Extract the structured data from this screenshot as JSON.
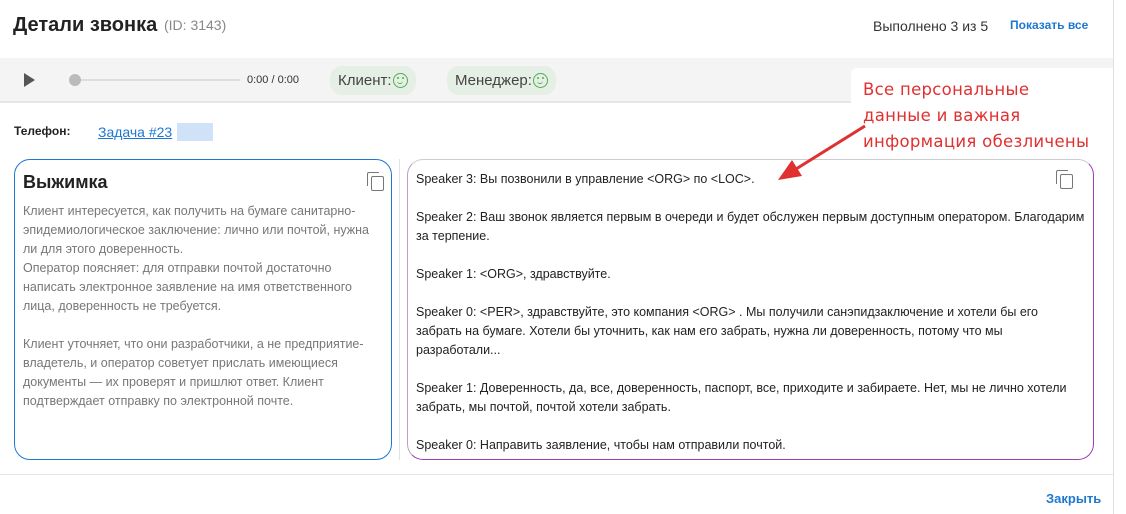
{
  "header": {
    "title": "Детали звонка",
    "call_id": "(ID: 3143)",
    "progress": "Выполнено 3 из 5",
    "show_all": "Показать все"
  },
  "player": {
    "time": "0:00 / 0:00",
    "position_fraction": 0,
    "client_label": "Клиент:",
    "client_mood": "smile-icon",
    "manager_label": "Менеджер:",
    "manager_mood": "smile-icon"
  },
  "info": {
    "phone_label": "Телефон:",
    "task_link": "Задача #23"
  },
  "summary": {
    "title": "Выжимка",
    "text": "Клиент интересуется, как получить на бумаге санитарно-эпидемиологическое заключение: лично или почтой, нужна ли для этого доверенность.\nОператор поясняет: для отправки почтой достаточно написать электронное заявление на имя ответственного лица, доверенность не требуется.\n\nКлиент уточняет, что они разработчики, а не предприятие-владетель, и оператор советует прислать имеющиеся документы — их проверят и пришлют ответ. Клиент подтверждает отправку по электронной почте."
  },
  "transcript": [
    "Speaker 3: Вы позвонили в управление <ORG> по <LOC>.",
    "Speaker 2: Ваш звонок является первым в очереди и будет обслужен первым доступным оператором. Благодарим за терпение.",
    "Speaker 1: <ORG>, здравствуйте.",
    "Speaker 0: <PER>, здравствуйте, это компания <ORG> .  Мы получили санэпидзаключение и хотели бы его забрать на бумаге.  Хотели бы уточнить, как нам его забрать, нужна ли доверенность, потому что мы разработали...",
    "Speaker 1: Доверенность, да, все, доверенность, паспорт, все, приходите и забираете.  Нет, мы не лично хотели забрать, мы почтой, почтой хотели забрать.",
    "Speaker 0: Направить заявление, чтобы нам отправили почтой."
  ],
  "annotation": {
    "text": "Все персональные данные и важная информация обезличены",
    "color": "#e03030"
  },
  "footer": {
    "close": "Закрыть"
  },
  "colors": {
    "accent": "#1e78d2",
    "summary_border": "#1e78d2",
    "transcript_border": "#9b3fb5"
  }
}
